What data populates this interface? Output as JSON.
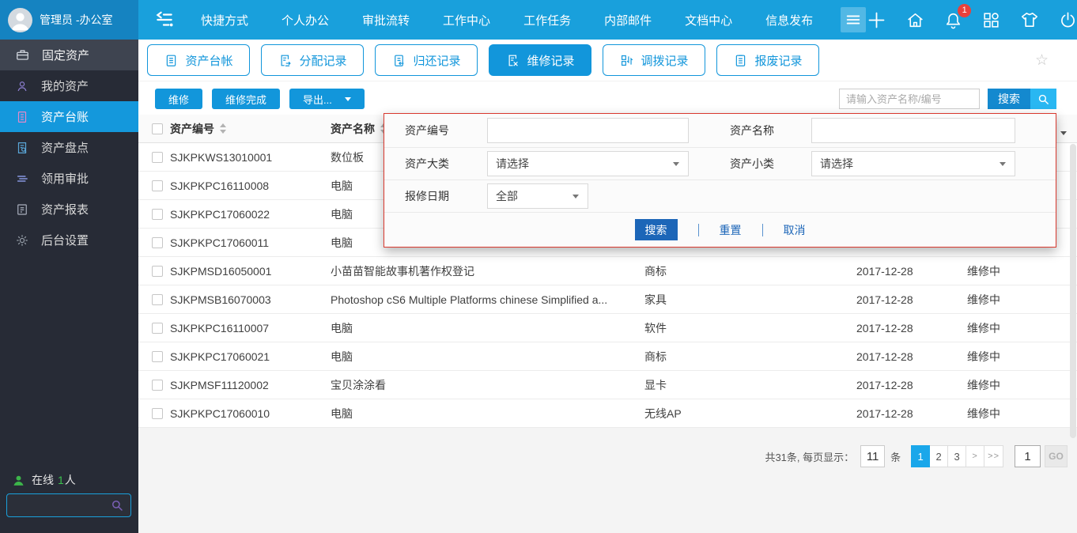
{
  "topbar": {
    "user_name": "管理员 -办公室",
    "nav": [
      "快捷方式",
      "个人办公",
      "审批流转",
      "工作中心",
      "工作任务",
      "内部邮件",
      "文档中心",
      "信息发布"
    ],
    "notification_badge": "1"
  },
  "sidebar": {
    "section_label": "固定资产",
    "items": [
      {
        "label": "我的资产"
      },
      {
        "label": "资产台账"
      },
      {
        "label": "资产盘点"
      },
      {
        "label": "领用审批"
      },
      {
        "label": "资产报表"
      },
      {
        "label": "后台设置"
      }
    ],
    "online_prefix": "在线",
    "online_count": "1",
    "online_suffix": "人"
  },
  "tabs": [
    {
      "label": "资产台帐"
    },
    {
      "label": "分配记录"
    },
    {
      "label": "归还记录"
    },
    {
      "label": "维修记录"
    },
    {
      "label": "调拨记录"
    },
    {
      "label": "报废记录"
    }
  ],
  "toolbar": {
    "repair_label": "维修",
    "repair_done_label": "维修完成",
    "export_label": "导出...",
    "search_placeholder": "请输入资产名称/编号",
    "search_label": "搜索"
  },
  "filter": {
    "asset_no_label": "资产编号",
    "asset_name_label": "资产名称",
    "major_label": "资产大类",
    "minor_label": "资产小类",
    "date_label": "报修日期",
    "select_placeholder": "请选择",
    "date_value": "全部",
    "search_label": "搜索",
    "reset_label": "重置",
    "cancel_label": "取消"
  },
  "table": {
    "col_no": "资产编号",
    "col_name": "资产名称",
    "rows": [
      {
        "no": "SJKPKWS13010001",
        "name": "数位板",
        "cat": "",
        "date": "",
        "status": ""
      },
      {
        "no": "SJKPKPC16110008",
        "name": "电脑",
        "cat": "",
        "date": "",
        "status": ""
      },
      {
        "no": "SJKPKPC17060022",
        "name": "电脑",
        "cat": "",
        "date": "",
        "status": ""
      },
      {
        "no": "SJKPKPC17060011",
        "name": "电脑",
        "cat": "",
        "date": "",
        "status": ""
      },
      {
        "no": "SJKPMSD16050001",
        "name": "小苗苗智能故事机著作权登记",
        "cat": "商标",
        "date": "2017-12-28",
        "status": "维修中"
      },
      {
        "no": "SJKPMSB16070003",
        "name": "Photoshop cS6 Multiple Platforms chinese Simplified a...",
        "cat": "家具",
        "date": "2017-12-28",
        "status": "维修中"
      },
      {
        "no": "SJKPKPC16110007",
        "name": "电脑",
        "cat": "软件",
        "date": "2017-12-28",
        "status": "维修中"
      },
      {
        "no": "SJKPKPC17060021",
        "name": "电脑",
        "cat": "商标",
        "date": "2017-12-28",
        "status": "维修中"
      },
      {
        "no": "SJKPMSF11120002",
        "name": "宝贝涂涂看",
        "cat": "显卡",
        "date": "2017-12-28",
        "status": "维修中"
      },
      {
        "no": "SJKPKPC17060010",
        "name": "电脑",
        "cat": "无线AP",
        "date": "2017-12-28",
        "status": "维修中"
      }
    ]
  },
  "pagination": {
    "summary": "共31条, 每页显示：",
    "page_size": "11",
    "unit": "条",
    "pages": [
      "1",
      "2",
      "3"
    ],
    "next": ">",
    "last": ">>",
    "goto_value": "1",
    "go_label": "GO"
  },
  "colors": {
    "topbar": "#19a0dc",
    "brand": "#1583c1",
    "sidebar": "#272b36",
    "accent": "#1296db",
    "active_page": "#1aa7ea",
    "popup_border": "#d9392f",
    "badge": "#e8413c",
    "online_green": "#3cc14e",
    "footer_button": "#1c66b8"
  }
}
